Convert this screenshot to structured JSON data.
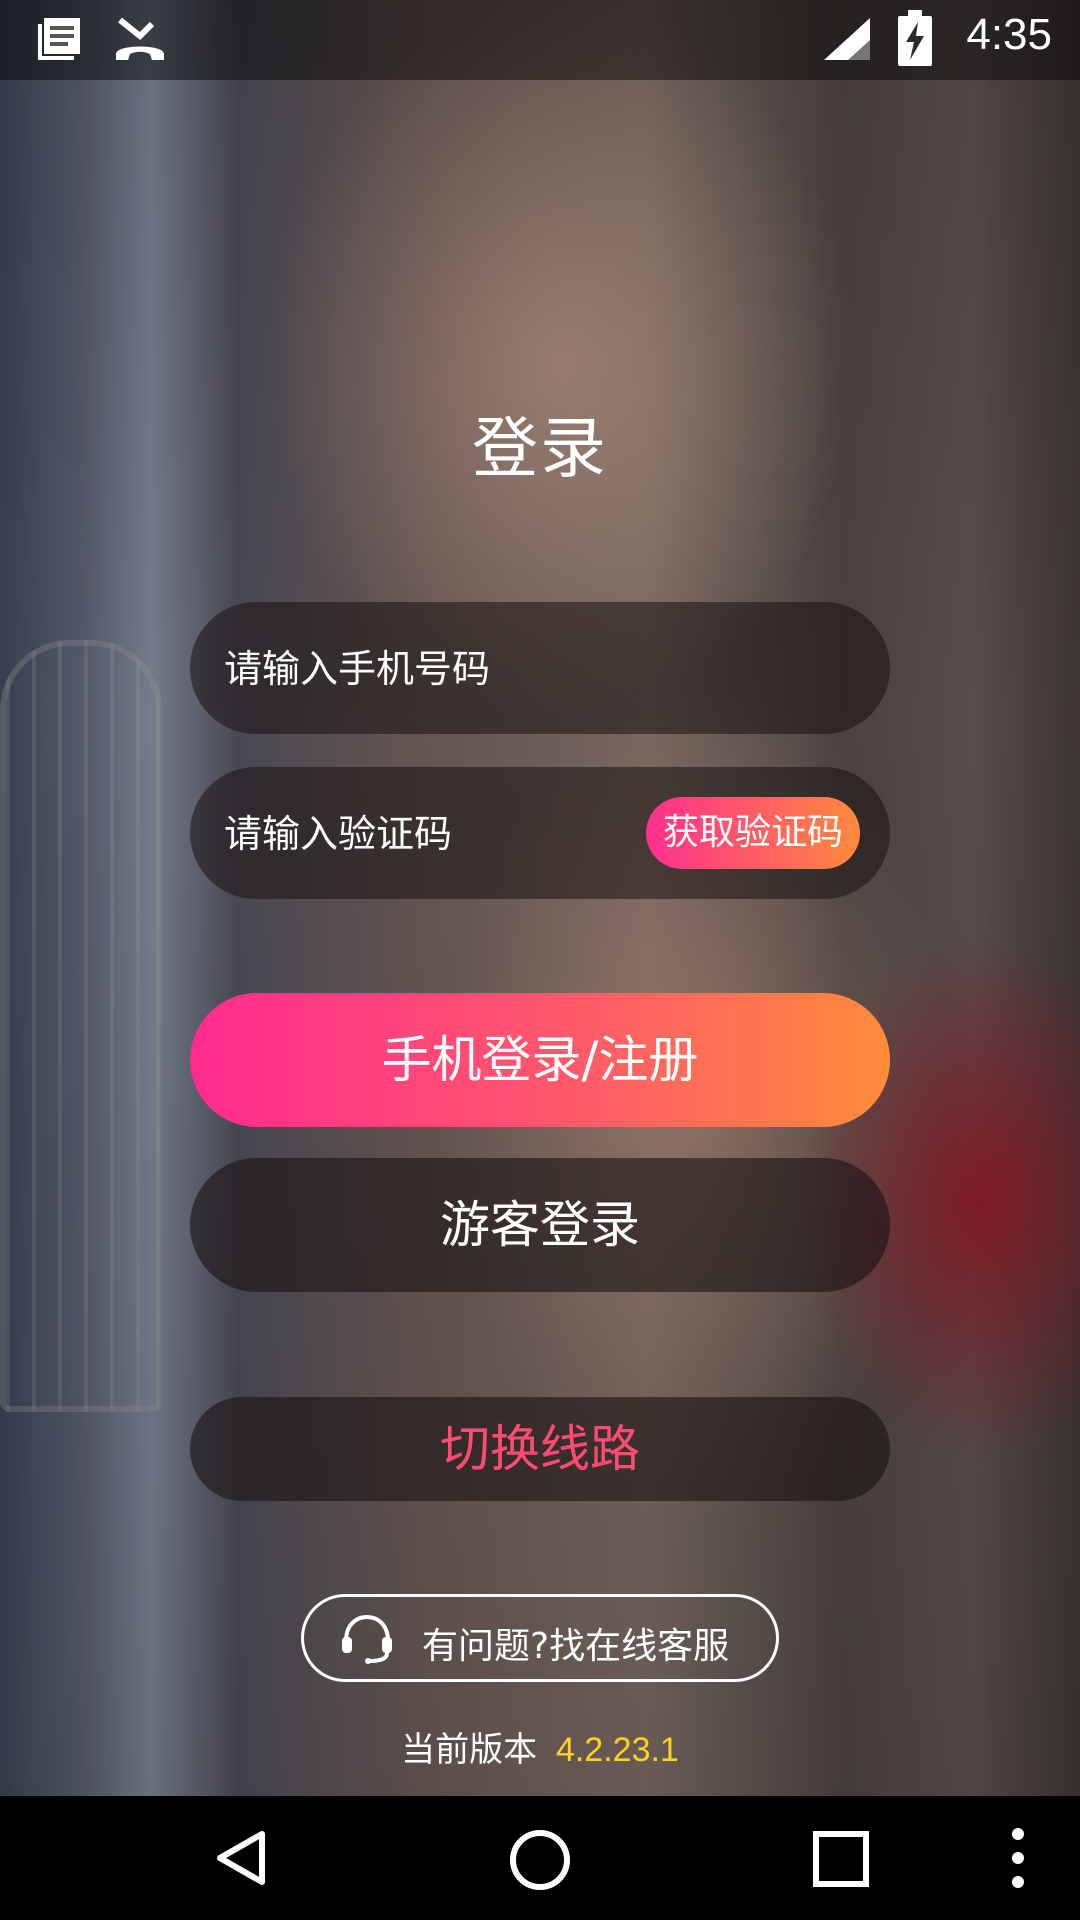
{
  "status_bar": {
    "time": "4:35",
    "icons": [
      "notification-icon",
      "missed-call-icon",
      "signal-icon",
      "battery-charging-icon"
    ]
  },
  "login": {
    "title": "登录",
    "phone_placeholder": "请输入手机号码",
    "code_placeholder": "请输入验证码",
    "get_code_label": "获取验证码",
    "phone_login_label": "手机登录/注册",
    "guest_login_label": "游客登录",
    "switch_route_label": "切换线路",
    "support_label": "有问题?找在线客服",
    "version_label": "当前版本",
    "version_number": "4.2.23.1"
  },
  "colors": {
    "accent_gradient_start": "#ff2b8f",
    "accent_gradient_end": "#ff8c3a",
    "switch_route_text": "#ff4b73",
    "version_number": "#ffd21e"
  },
  "nav_bar": {
    "icons": [
      "back-icon",
      "home-icon",
      "recents-icon",
      "more-icon"
    ]
  }
}
